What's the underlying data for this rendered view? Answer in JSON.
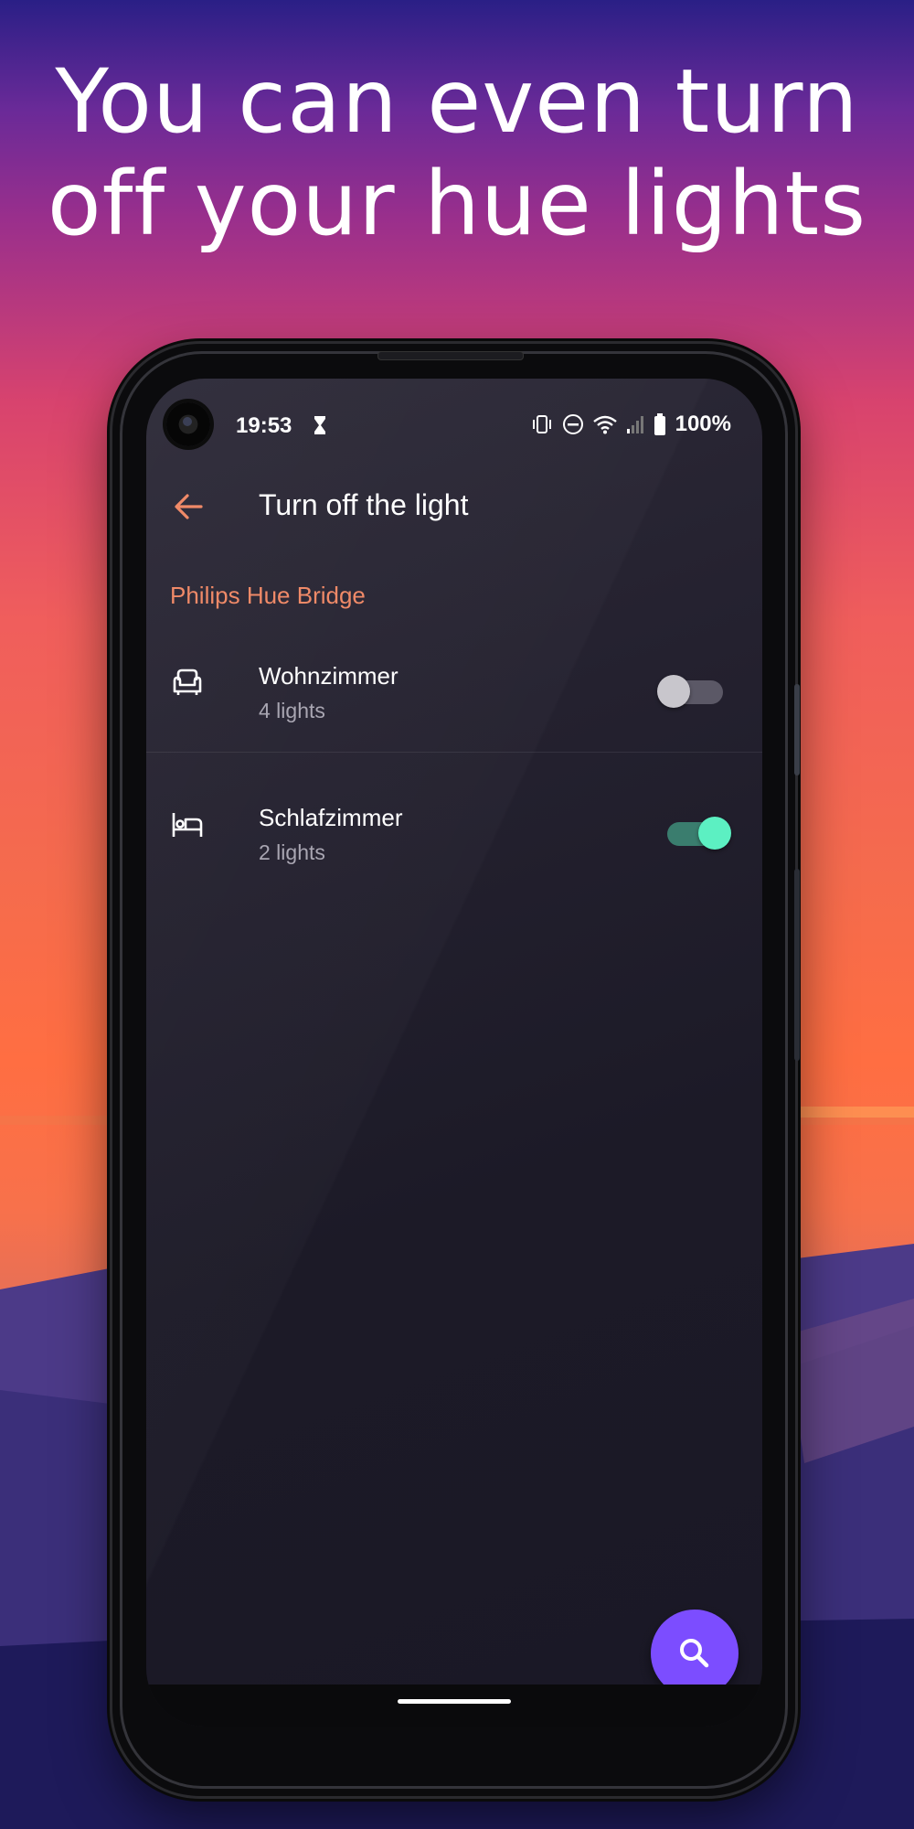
{
  "headline": {
    "line1": "You can even turn",
    "line2": "off your hue lights"
  },
  "status_bar": {
    "time": "19:53",
    "battery": "100%",
    "icons": [
      "hourglass-icon",
      "vibrate-icon",
      "do-not-disturb-icon",
      "wifi-icon",
      "signal-icon",
      "battery-icon"
    ]
  },
  "app_bar": {
    "title": "Turn off the light",
    "back_icon": "arrow-left-icon"
  },
  "section": {
    "header": "Philips Hue Bridge"
  },
  "rooms": [
    {
      "name": "Wohnzimmer",
      "subtitle": "4 lights",
      "icon": "armchair-icon",
      "on": false
    },
    {
      "name": "Schlafzimmer",
      "subtitle": "2 lights",
      "icon": "bed-icon",
      "on": true
    }
  ],
  "fab": {
    "icon": "search-icon"
  },
  "colors": {
    "accent": "#f08a68",
    "fab": "#7c4dff",
    "toggle_on": "#5cf0c2",
    "screen_bg": "#1c1a27"
  }
}
